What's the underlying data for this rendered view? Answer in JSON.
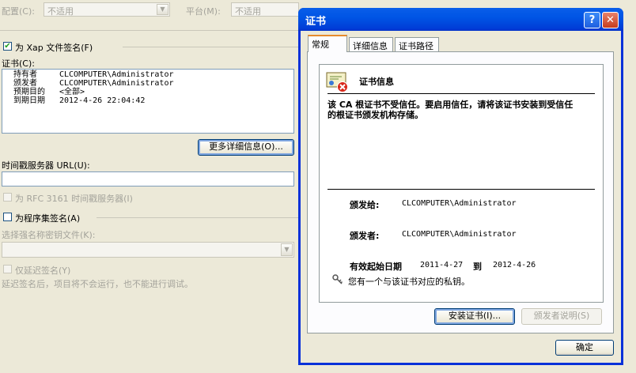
{
  "background_form": {
    "config_label": "配置(C):",
    "config_value": "不适用",
    "platform_label": "平台(M):",
    "platform_value": "不适用",
    "sign_xap_label": "为 Xap 文件签名(F)",
    "cert_label": "证书(C):",
    "cert_rows": [
      {
        "key": "持有者",
        "value": "CLCOMPUTER\\Administrator"
      },
      {
        "key": "颁发者",
        "value": "CLCOMPUTER\\Administrator"
      },
      {
        "key": "预期目的",
        "value": "<全部>"
      },
      {
        "key": "到期日期",
        "value": "2012-4-26 22:04:42"
      }
    ],
    "more_details_button": "更多详细信息(O)...",
    "timestamp_label": "时间戳服务器 URL(U):",
    "timestamp_value": "",
    "rfc_label": "为 RFC 3161 时间戳服务器(I)",
    "sign_assembly_label": "为程序集签名(A)",
    "strong_name_label": "选择强名称密钥文件(K):",
    "delay_sign_label": "仅延迟签名(Y)",
    "delay_sign_note": "延迟签名后，项目将不会运行，也不能进行调试。"
  },
  "dialog": {
    "title": "证书",
    "help_glyph": "?",
    "close_glyph": "✕",
    "tabs": [
      "常规",
      "详细信息",
      "证书路径"
    ],
    "active_tab": 0,
    "cert_info_heading": "证书信息",
    "warning_text": "该 CA 根证书不受信任。要启用信任，请将该证书安装到受信任的根证书颁发机构存储。",
    "issued_to_label": "颁发给:",
    "issued_to_value": "CLCOMPUTER\\Administrator",
    "issued_by_label": "颁发者:",
    "issued_by_value": "CLCOMPUTER\\Administrator",
    "valid_from_label": "有效起始日期",
    "valid_from_value": "2011-4-27",
    "valid_to_label": "到",
    "valid_to_value": "2012-4-26",
    "private_key_note": "您有一个与该证书对应的私钥。",
    "install_button": "安装证书(I)...",
    "issuer_statement_button": "颁发者说明(S)",
    "ok_button": "确定"
  },
  "colors": {
    "titlebar": "#0055e5",
    "close_button": "#e04a2c",
    "window_face": "#ece9d8"
  }
}
